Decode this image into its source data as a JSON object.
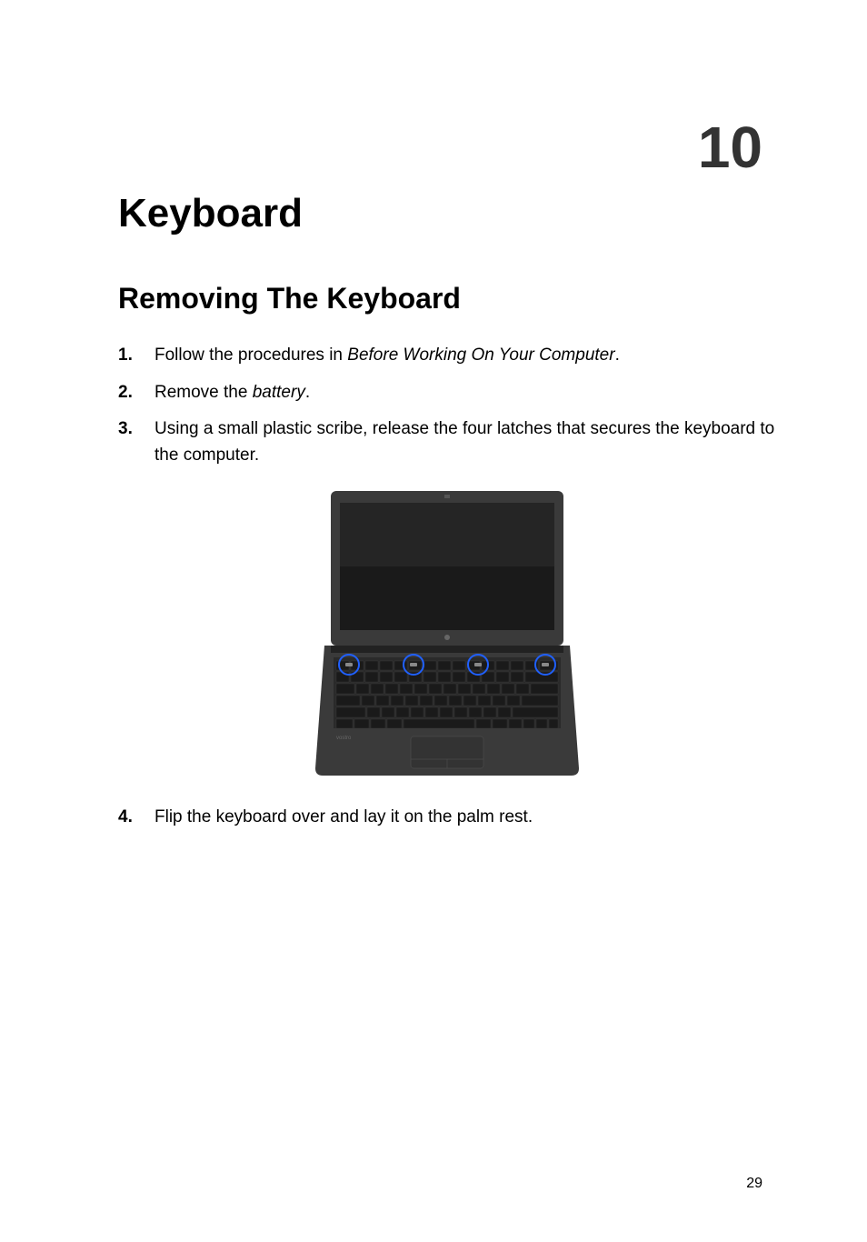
{
  "chapter": {
    "number": "10",
    "title": "Keyboard"
  },
  "section": {
    "heading": "Removing The Keyboard"
  },
  "steps": [
    {
      "number": "1.",
      "prefix": "Follow the procedures in ",
      "link": "Before Working On Your Computer",
      "suffix": "."
    },
    {
      "number": "2.",
      "prefix": "Remove the ",
      "link": "battery",
      "suffix": "."
    },
    {
      "number": "3.",
      "prefix": "Using a small plastic scribe, release the four latches that secures the keyboard to the computer.",
      "link": "",
      "suffix": ""
    },
    {
      "number": "4.",
      "prefix": "Flip the keyboard over and lay it on the palm rest.",
      "link": "",
      "suffix": ""
    }
  ],
  "pageNumber": "29"
}
